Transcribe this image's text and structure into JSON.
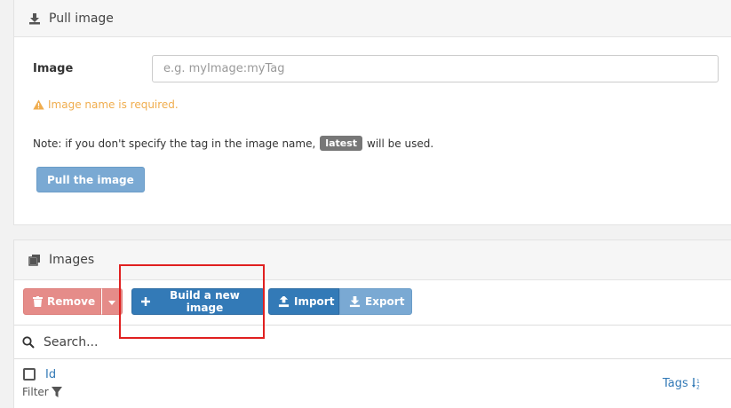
{
  "pull_section": {
    "title": "Pull image",
    "title_icon": "download-icon",
    "image_label": "Image",
    "image_input_placeholder": "e.g. myImage:myTag",
    "image_input_value": "",
    "warning_text": "Image name is required.",
    "note_prefix": "Note: if you don't specify the tag in the image name,",
    "note_badge": "latest",
    "note_suffix": "will be used.",
    "pull_button": "Pull the image"
  },
  "images_section": {
    "title": "Images",
    "title_icon": "clone-icon",
    "remove_button": "Remove",
    "build_button": "Build a new image",
    "import_button": "Import",
    "export_button": "Export",
    "search_placeholder": "Search...",
    "column_id": "Id",
    "filter_label": "Filter",
    "column_tags": "Tags"
  },
  "colors": {
    "primary": "#337ab7",
    "danger": "#e58c89",
    "warning": "#f0ad4e",
    "highlight": "#e02020"
  }
}
